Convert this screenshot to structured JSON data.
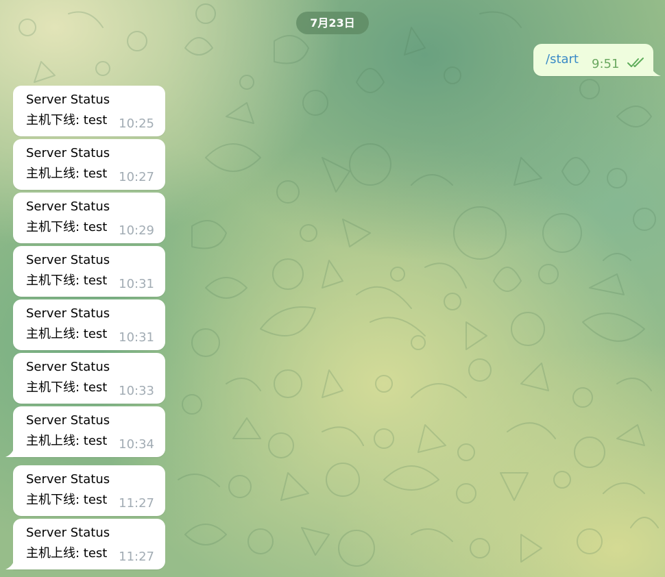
{
  "chat": {
    "date_label": "7月23日",
    "outgoing": {
      "text": "/start",
      "time": "9:51",
      "status_icon": "double-check-icon",
      "check_color": "#5dac5a"
    },
    "messages": [
      {
        "title": "Server Status",
        "body": "主机下线: test",
        "time": "10:25"
      },
      {
        "title": "Server Status",
        "body": "主机上线: test",
        "time": "10:27"
      },
      {
        "title": "Server Status",
        "body": "主机下线: test",
        "time": "10:29"
      },
      {
        "title": "Server Status",
        "body": "主机下线: test",
        "time": "10:31"
      },
      {
        "title": "Server Status",
        "body": "主机上线: test",
        "time": "10:31"
      },
      {
        "title": "Server Status",
        "body": "主机下线: test",
        "time": "10:33"
      },
      {
        "title": "Server Status",
        "body": "主机上线: test",
        "time": "10:34"
      },
      {
        "title": "Server Status",
        "body": "主机下线: test",
        "time": "11:27"
      },
      {
        "title": "Server Status",
        "body": "主机上线: test",
        "time": "11:27"
      }
    ]
  },
  "colors": {
    "incoming_bubble": "#ffffff",
    "outgoing_bubble": "#effdde",
    "link_text": "#3a8ac6",
    "date_pill": "#5c8660"
  }
}
